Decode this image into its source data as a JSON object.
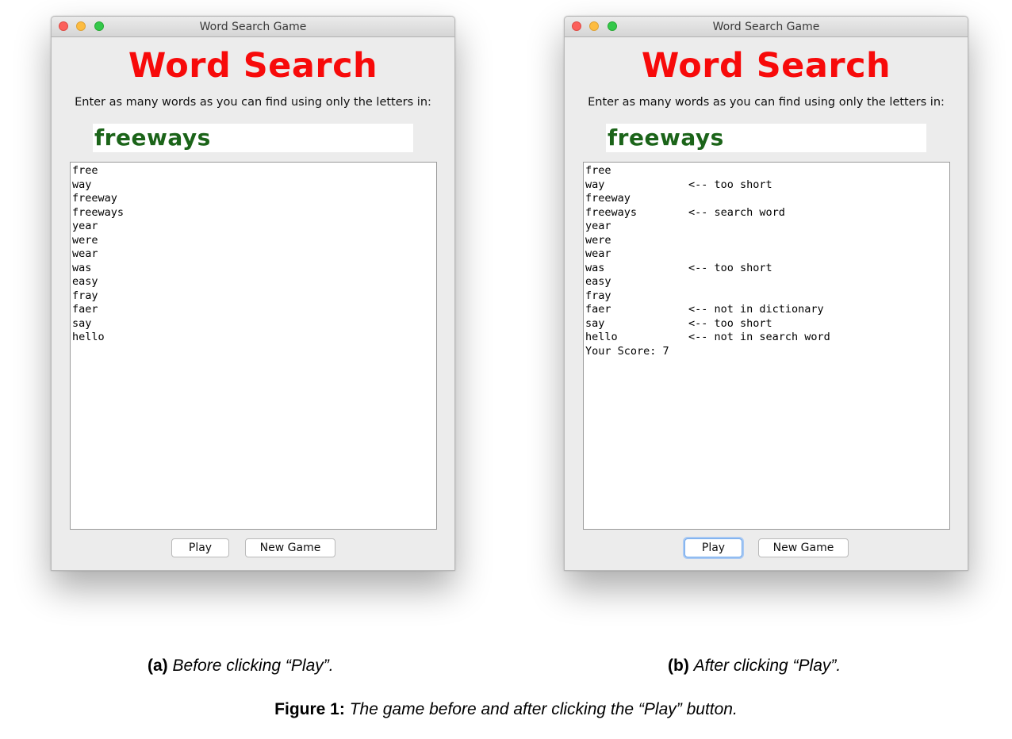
{
  "window_a": {
    "title": "Word Search Game",
    "heading": "Word Search",
    "instructions": "Enter as many words as you can find using only the letters in:",
    "letters": "freeways",
    "lines": [
      {
        "word": "free",
        "msg": ""
      },
      {
        "word": "way",
        "msg": ""
      },
      {
        "word": "freeway",
        "msg": ""
      },
      {
        "word": "freeways",
        "msg": ""
      },
      {
        "word": "year",
        "msg": ""
      },
      {
        "word": "were",
        "msg": ""
      },
      {
        "word": "wear",
        "msg": ""
      },
      {
        "word": "was",
        "msg": ""
      },
      {
        "word": "easy",
        "msg": ""
      },
      {
        "word": "fray",
        "msg": ""
      },
      {
        "word": "faer",
        "msg": ""
      },
      {
        "word": "say",
        "msg": ""
      },
      {
        "word": "hello",
        "msg": ""
      }
    ],
    "play_label": "Play",
    "new_game_label": "New Game"
  },
  "window_b": {
    "title": "Word Search Game",
    "heading": "Word Search",
    "instructions": "Enter as many words as you can find using only the letters in:",
    "letters": "freeways",
    "lines": [
      {
        "word": "free",
        "msg": ""
      },
      {
        "word": "way",
        "msg": "<-- too short"
      },
      {
        "word": "freeway",
        "msg": ""
      },
      {
        "word": "freeways",
        "msg": "<-- search word"
      },
      {
        "word": "year",
        "msg": ""
      },
      {
        "word": "were",
        "msg": ""
      },
      {
        "word": "wear",
        "msg": ""
      },
      {
        "word": "was",
        "msg": "<-- too short"
      },
      {
        "word": "easy",
        "msg": ""
      },
      {
        "word": "fray",
        "msg": ""
      },
      {
        "word": "faer",
        "msg": "<-- not in dictionary"
      },
      {
        "word": "say",
        "msg": "<-- too short"
      },
      {
        "word": "hello",
        "msg": "<-- not in search word"
      },
      {
        "word": "Your Score: 7",
        "msg": ""
      }
    ],
    "play_label": "Play",
    "new_game_label": "New Game"
  },
  "captions": {
    "a_label": "(a)",
    "a_text": "Before clicking “Play”.",
    "b_label": "(b)",
    "b_text": "After clicking “Play”.",
    "figure_label": "Figure 1:",
    "figure_text": "The game before and after clicking the “Play” button."
  },
  "colors": {
    "heading": "#f70a0a",
    "letters": "#1b6419",
    "focus_ring": "#6fa8ec"
  }
}
